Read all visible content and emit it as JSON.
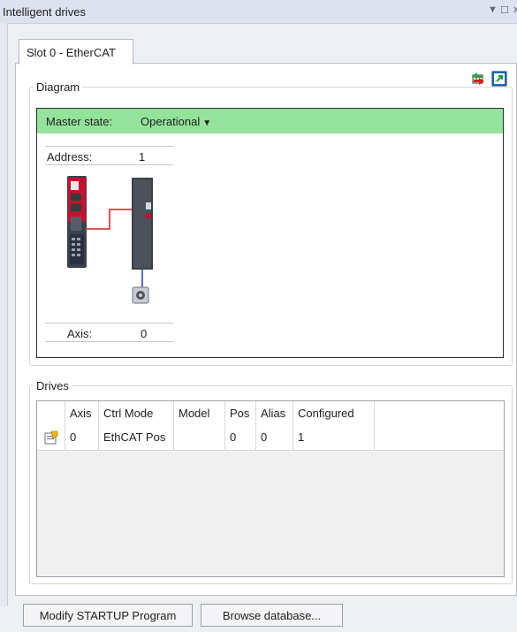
{
  "window": {
    "title": "Intelligent drives"
  },
  "tabs": [
    {
      "label": "Slot 0 - EtherCAT",
      "active": true
    }
  ],
  "toolbar": {
    "refresh_icon": "refresh-icon",
    "expand_icon": "expand-icon"
  },
  "diagram": {
    "legend": "Diagram",
    "master_state_label": "Master state:",
    "master_state_value": "Operational",
    "address_label": "Address:",
    "address_value": "1",
    "axis_label": "Axis:",
    "axis_value": "0",
    "colors": {
      "state_bar": "#94e39b",
      "link_red": "#e0191f",
      "link_blue": "#1f3fd6"
    }
  },
  "drives": {
    "legend": "Drives",
    "columns": [
      "",
      "Axis",
      "Ctrl Mode",
      "Model",
      "Pos",
      "Alias",
      "Configured"
    ],
    "rows": [
      {
        "icon": "drive-properties-icon",
        "axis": "0",
        "ctrl_mode": "EthCAT Pos",
        "model": "",
        "pos": "0",
        "alias": "0",
        "configured": "1"
      }
    ]
  },
  "buttons": {
    "modify_startup": "Modify STARTUP Program",
    "browse_database": "Browse database..."
  }
}
